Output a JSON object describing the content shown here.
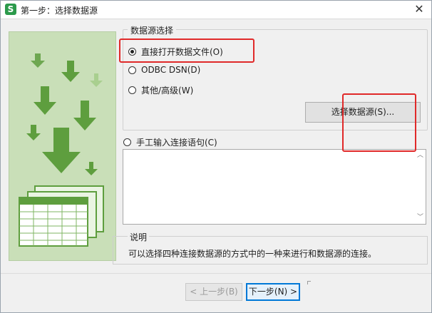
{
  "window": {
    "title": "第一步：选择数据源",
    "app_icon_letter": "S",
    "close_label": "✕"
  },
  "data_source": {
    "legend": "数据源选择",
    "options": [
      {
        "label": "直接打开数据文件(O)",
        "checked": true
      },
      {
        "label": "ODBC DSN(D)",
        "checked": false
      },
      {
        "label": "其他/高级(W)",
        "checked": false
      }
    ],
    "select_button": "选择数据源(S)..."
  },
  "manual": {
    "label": "手工输入连接语句(C)",
    "checked": false,
    "value": ""
  },
  "description": {
    "legend": "说明",
    "text": "可以选择四种连接数据源的方式中的一种来进行和数据源的连接。"
  },
  "footer": {
    "prev_button": "< 上一步(B)",
    "next_button": "下一步(N) >"
  },
  "colors": {
    "panel_bg": "#c9dfb8",
    "arrow_green": "#5e9e3e",
    "highlight_red": "#e02929"
  }
}
